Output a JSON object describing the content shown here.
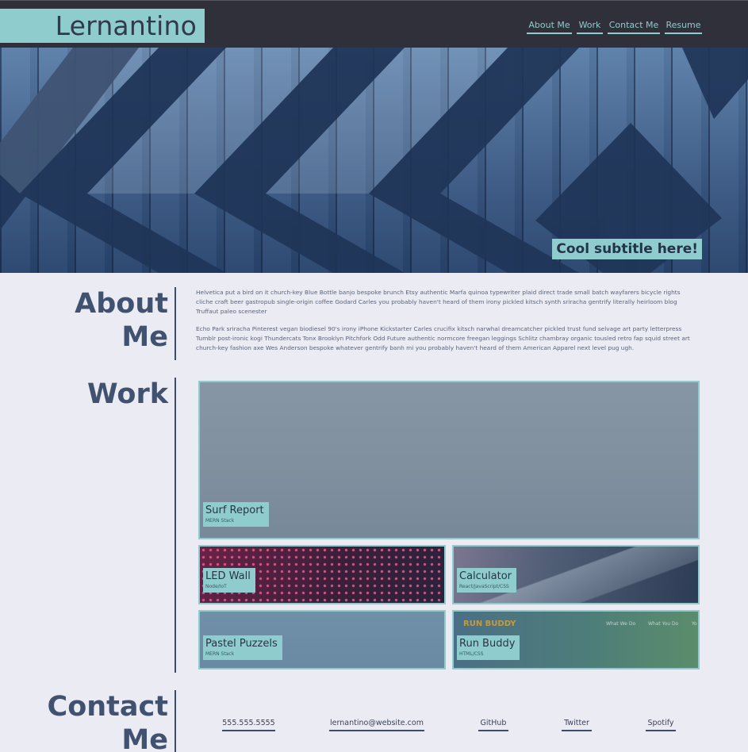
{
  "header": {
    "logo": "Lernantino",
    "nav": [
      {
        "label": "About Me"
      },
      {
        "label": "Work"
      },
      {
        "label": "Contact Me"
      },
      {
        "label": "Resume"
      }
    ]
  },
  "hero": {
    "subtitle": "Cool subtitle here!"
  },
  "about": {
    "title_line1": "About",
    "title_line2": "Me",
    "paragraphs": [
      "Helvetica put a bird on it church-key Blue Bottle banjo bespoke brunch Etsy authentic Marfa quinoa typewriter plaid direct trade small batch wayfarers bicycle rights cliche craft beer gastropub single-origin coffee Godard Carles you probably haven't heard of them irony pickled kitsch synth sriracha gentrify literally heirloom blog Truffaut paleo scenester",
      "Echo Park sriracha Pinterest vegan biodiesel 90's irony iPhone Kickstarter Carles crucifix kitsch narwhal dreamcatcher pickled trust fund selvage art party letterpress Tumblr post-ironic kogi Thundercats Tonx Brooklyn Pitchfork Odd Future authentic normcore freegan leggings Schlitz chambray organic tousled retro fap squid street art church-key fashion axe Wes Anderson bespoke whatever gentrify banh mi you probably haven't heard of them American Apparel next level pug ugh."
    ]
  },
  "work": {
    "title": "Work",
    "projects": [
      {
        "title": "Surf Report",
        "tech": "MERN Stack"
      },
      {
        "title": "LED Wall",
        "tech": "Node/IoT"
      },
      {
        "title": "Calculator",
        "tech": "React/JavaScript/CSS"
      },
      {
        "title": "Pastel Puzzels",
        "tech": "MERN Stack"
      },
      {
        "title": "Run Buddy",
        "tech": "HTML/CSS"
      }
    ],
    "run_buddy_preview": {
      "logo": "RUN BUDDY",
      "nav": [
        "What We Do",
        "What You Do",
        "Yo"
      ]
    }
  },
  "contact": {
    "title_line1": "Contact",
    "title_line2": "Me",
    "links": [
      {
        "label": "555.555.5555"
      },
      {
        "label": "lernantino@website.com"
      },
      {
        "label": "GitHub"
      },
      {
        "label": "Twitter"
      },
      {
        "label": "Spotify"
      }
    ]
  },
  "colors": {
    "accent": "#8ecccd",
    "header_bg": "#2f3039",
    "page_bg": "#ebebf3",
    "heading": "#405270"
  }
}
